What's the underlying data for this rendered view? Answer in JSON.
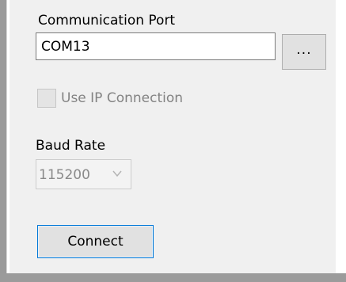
{
  "communication_port": {
    "label": "Communication Port",
    "value": "COM13",
    "browse_label": "..."
  },
  "ip_connection": {
    "label": "Use IP Connection",
    "checked": false,
    "enabled": false
  },
  "baud_rate": {
    "label": "Baud Rate",
    "value": "115200",
    "enabled": false
  },
  "connect_label": "Connect"
}
